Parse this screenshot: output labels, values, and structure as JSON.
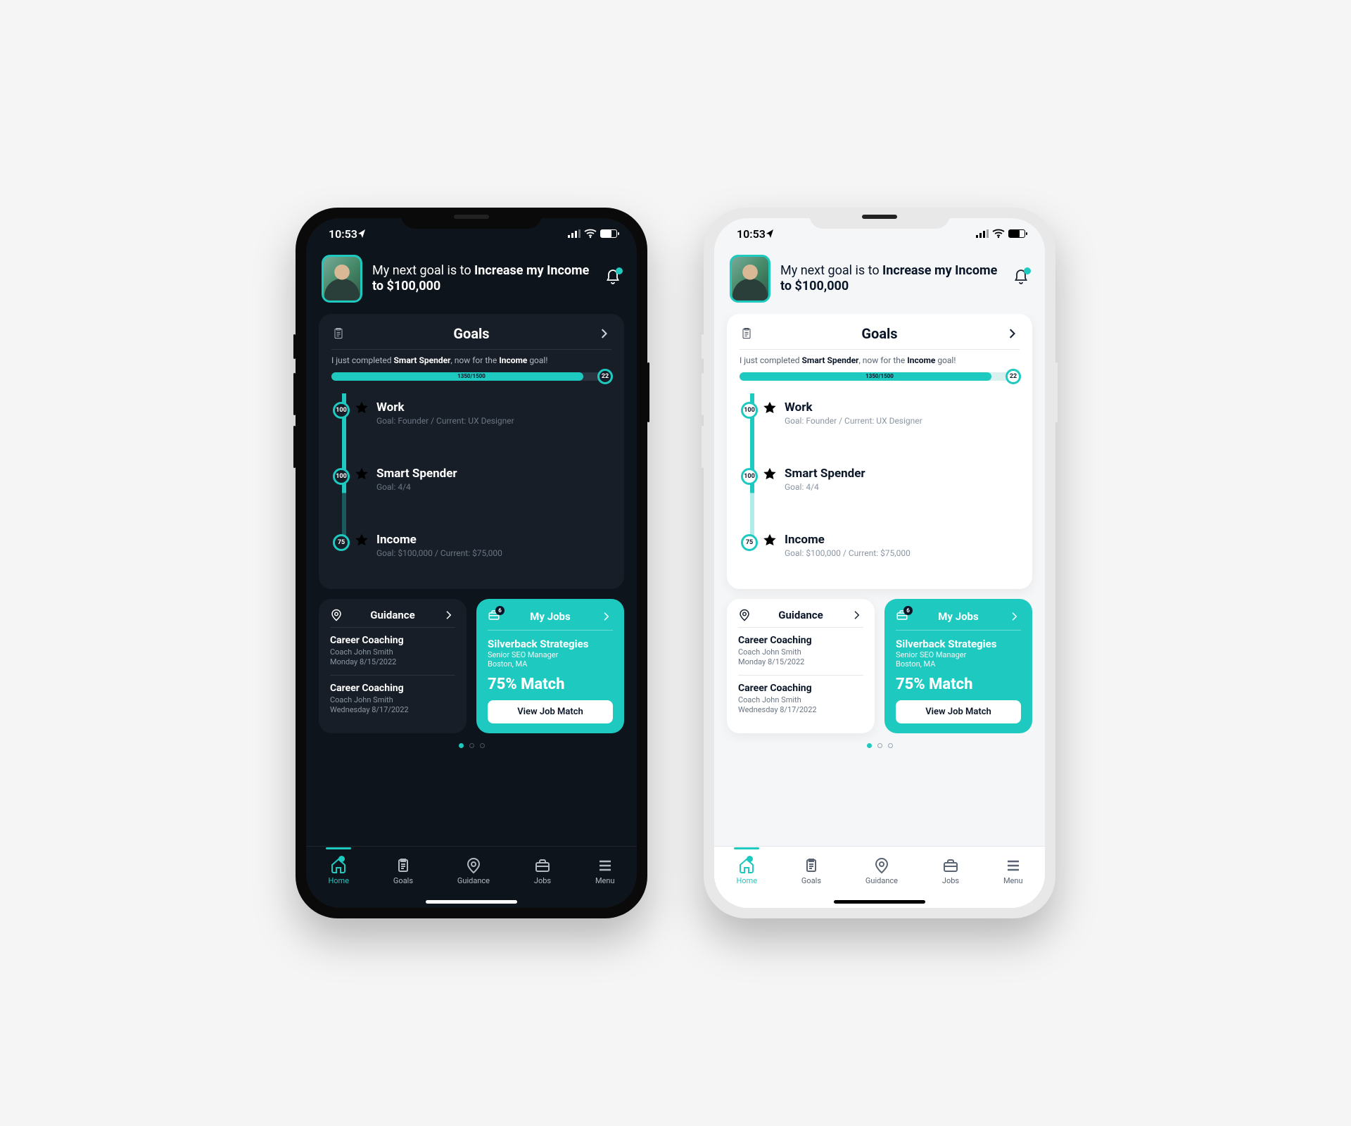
{
  "status": {
    "time": "10:53"
  },
  "header": {
    "goal_prefix": "My next goal is to ",
    "goal_bold": "Increase my Income to $100,000"
  },
  "goals": {
    "title": "Goals",
    "completed_prefix": "I just completed ",
    "completed_goal": "Smart Spender",
    "completed_mid": ", now for the ",
    "completed_next": "Income",
    "completed_suffix": " goal!",
    "progress_label": "1350/1500",
    "progress_cap": "22",
    "items": [
      {
        "badge": "100",
        "name": "Work",
        "sub": "Goal: Founder / Current: UX Designer",
        "star": "filled"
      },
      {
        "badge": "100",
        "name": "Smart Spender",
        "sub": "Goal: 4/4",
        "star": "filled"
      },
      {
        "badge": "75",
        "name": "Income",
        "sub": "Goal: $100,000 / Current: $75,000",
        "star": "empty"
      }
    ]
  },
  "guidance": {
    "title": "Guidance",
    "items": [
      {
        "name": "Career Coaching",
        "coach": "Coach John Smith",
        "date": "Monday 8/15/2022"
      },
      {
        "name": "Career Coaching",
        "coach": "Coach John Smith",
        "date": "Wednesday 8/17/2022"
      }
    ]
  },
  "jobs": {
    "title": "My Jobs",
    "badge": "6",
    "company": "Silverback Strategies",
    "role": "Senior SEO Manager",
    "location": "Boston, MA",
    "match": "75% Match",
    "button": "View Job Match"
  },
  "nav": {
    "tabs": [
      {
        "label": "Home"
      },
      {
        "label": "Goals"
      },
      {
        "label": "Guidance"
      },
      {
        "label": "Jobs"
      },
      {
        "label": "Menu"
      }
    ]
  }
}
